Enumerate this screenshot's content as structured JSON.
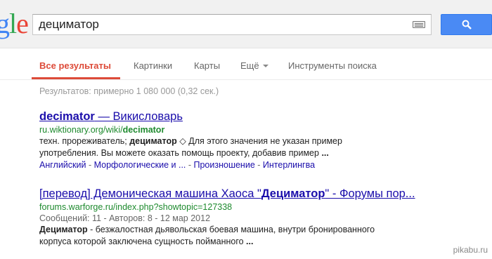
{
  "logo": {
    "p1": "g",
    "p2": "l",
    "p3": "e"
  },
  "search": {
    "query": "дециматор"
  },
  "tabs": [
    {
      "label": "Все результаты"
    },
    {
      "label": "Картинки"
    },
    {
      "label": "Карты"
    },
    {
      "label": "Ещё"
    },
    {
      "label": "Инструменты поиска"
    }
  ],
  "stats": "Результатов: примерно 1 080 000 (0,32 сек.)",
  "results": [
    {
      "title_bold": "decimator",
      "title_rest": " — Викисловарь",
      "url_plain": "ru.wiktionary.org/wiki/",
      "url_bold": "decimator",
      "line1_a": "техн. прореживатель; ",
      "line1_bold": "дециматор",
      "line1_b": " ◇ Для этого значения не указан пример",
      "line2_a": "употребления. Вы можете оказать помощь проекту, добавив пример ",
      "line2_bold": "...",
      "sitelinks": [
        "Английский",
        "Морфологические и ...",
        "Произношение",
        "Интерлингва"
      ],
      "sitelink_sep": " - "
    },
    {
      "title_a": "[перевод] Демоническая машина Хаоса \"",
      "title_bold": "Дециматор",
      "title_b": "\" - Форумы пор...",
      "url": "forums.warforge.ru/index.php?showtopic=127338",
      "meta": "Сообщений: 11 - Авторов: 8 - 12 мар 2012",
      "line1_bold": "Дециматор",
      "line1_rest": " - безжалостная дьявольская боевая машина, внутри бронированного",
      "line2_a": "корпуса которой заключена сущность пойманного ",
      "line2_bold": "..."
    }
  ],
  "watermark": "pikabu.ru",
  "colors": {
    "accent": "#dd4b39",
    "link": "#1a0dab",
    "url": "#1e8a2e",
    "button": "#4a8af4"
  }
}
